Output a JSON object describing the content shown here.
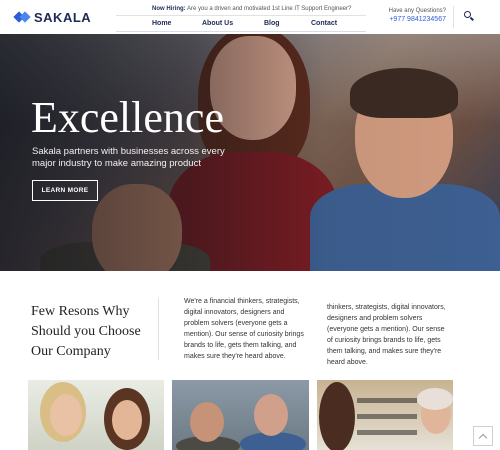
{
  "brand": {
    "name": "SAKALA",
    "primary_color": "#2f5bd3",
    "dark_color": "#1d2a55"
  },
  "header": {
    "hiring_label": "Now Hiring:",
    "hiring_text": "Are you a driven and motivated 1st Line IT Support Engineer?",
    "nav": [
      {
        "label": "Home"
      },
      {
        "label": "About Us"
      },
      {
        "label": "Blog"
      },
      {
        "label": "Contact"
      }
    ],
    "questions_label": "Have any Questions?",
    "phone": "+977 9841234567",
    "search_icon": "search-icon"
  },
  "hero": {
    "title": "Excellence",
    "subtitle": "Sakala partners with businesses across every major industry to make amazing product",
    "button_label": "LEARN MORE"
  },
  "reasons": {
    "title": "Few Resons Why Should you Choose Our Company",
    "column1": "We're a financial thinkers, strategists, digital innovators, designers and problem solvers (everyone gets a mention). Our sense of curiosity brings brands to life, gets them talking, and makes sure they're heard above.",
    "column2": "thinkers, strategists, digital innovators, designers and problem solvers (everyone gets a mention). Our sense of curiosity brings brands to life, gets them talking, and makes sure they're heard above."
  },
  "scroll_top_icon": "chevron-up-icon"
}
